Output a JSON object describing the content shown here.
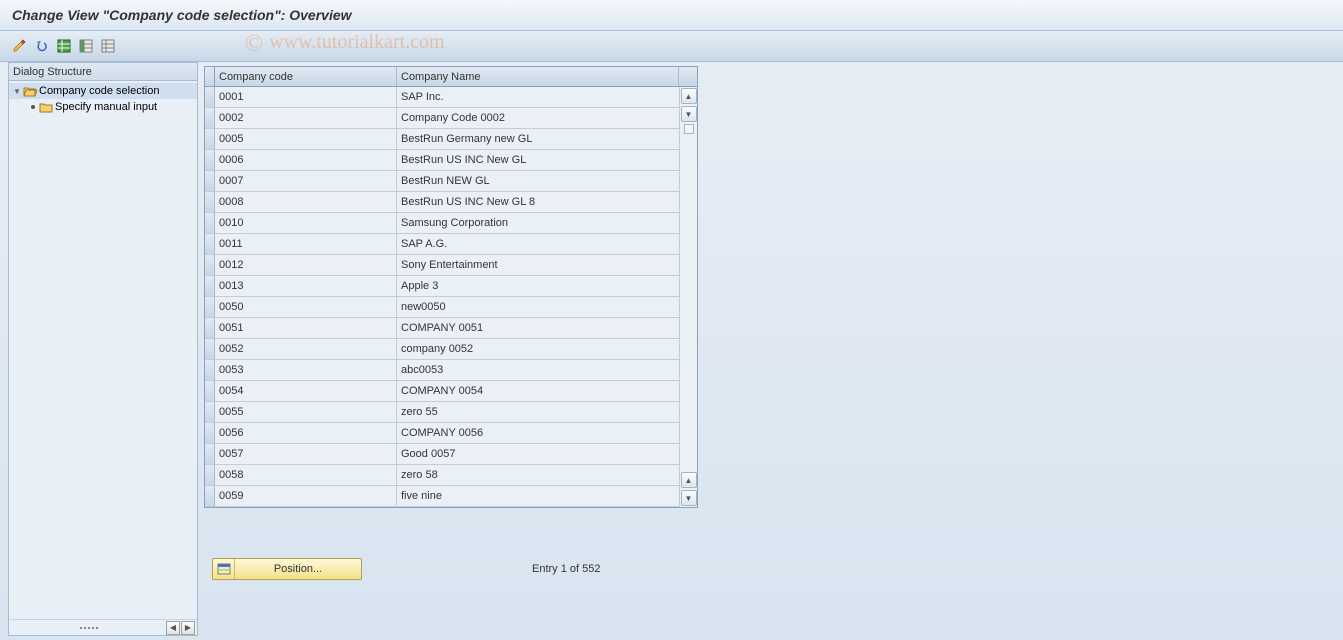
{
  "title": "Change View \"Company code selection\": Overview",
  "watermark": "www.tutorialkart.com",
  "toolbar": {
    "tooltips": {
      "other": "Other view",
      "undo": "Undo",
      "select_all": "Select All",
      "select_block": "Select Block",
      "deselect": "Deselect All"
    }
  },
  "leftPanel": {
    "header": "Dialog Structure",
    "items": [
      {
        "label": "Company code selection",
        "expanded": true,
        "selected": true,
        "iconType": "folder-open"
      },
      {
        "label": "Specify manual input",
        "child": true,
        "iconType": "folder-closed"
      }
    ]
  },
  "table": {
    "headers": {
      "code": "Company code",
      "name": "Company Name"
    },
    "rows": [
      {
        "code": "0001",
        "name": "SAP Inc."
      },
      {
        "code": "0002",
        "name": "Company Code 0002"
      },
      {
        "code": "0005",
        "name": "BestRun Germany new GL"
      },
      {
        "code": "0006",
        "name": "BestRun US INC New GL"
      },
      {
        "code": "0007",
        "name": "BestRun NEW GL"
      },
      {
        "code": "0008",
        "name": "BestRun US INC New GL 8"
      },
      {
        "code": "0010",
        "name": "Samsung Corporation"
      },
      {
        "code": "0011",
        "name": "SAP A.G."
      },
      {
        "code": "0012",
        "name": "Sony Entertainment"
      },
      {
        "code": "0013",
        "name": "Apple 3"
      },
      {
        "code": "0050",
        "name": "new0050"
      },
      {
        "code": "0051",
        "name": "COMPANY 0051"
      },
      {
        "code": "0052",
        "name": "company 0052"
      },
      {
        "code": "0053",
        "name": "abc0053"
      },
      {
        "code": "0054",
        "name": "COMPANY 0054"
      },
      {
        "code": "0055",
        "name": "zero 55"
      },
      {
        "code": "0056",
        "name": "COMPANY 0056"
      },
      {
        "code": "0057",
        "name": "Good 0057"
      },
      {
        "code": "0058",
        "name": "zero 58"
      },
      {
        "code": "0059",
        "name": "five nine"
      }
    ]
  },
  "bottom": {
    "positionLabel": "Position...",
    "entryStatus": "Entry 1 of 552"
  }
}
